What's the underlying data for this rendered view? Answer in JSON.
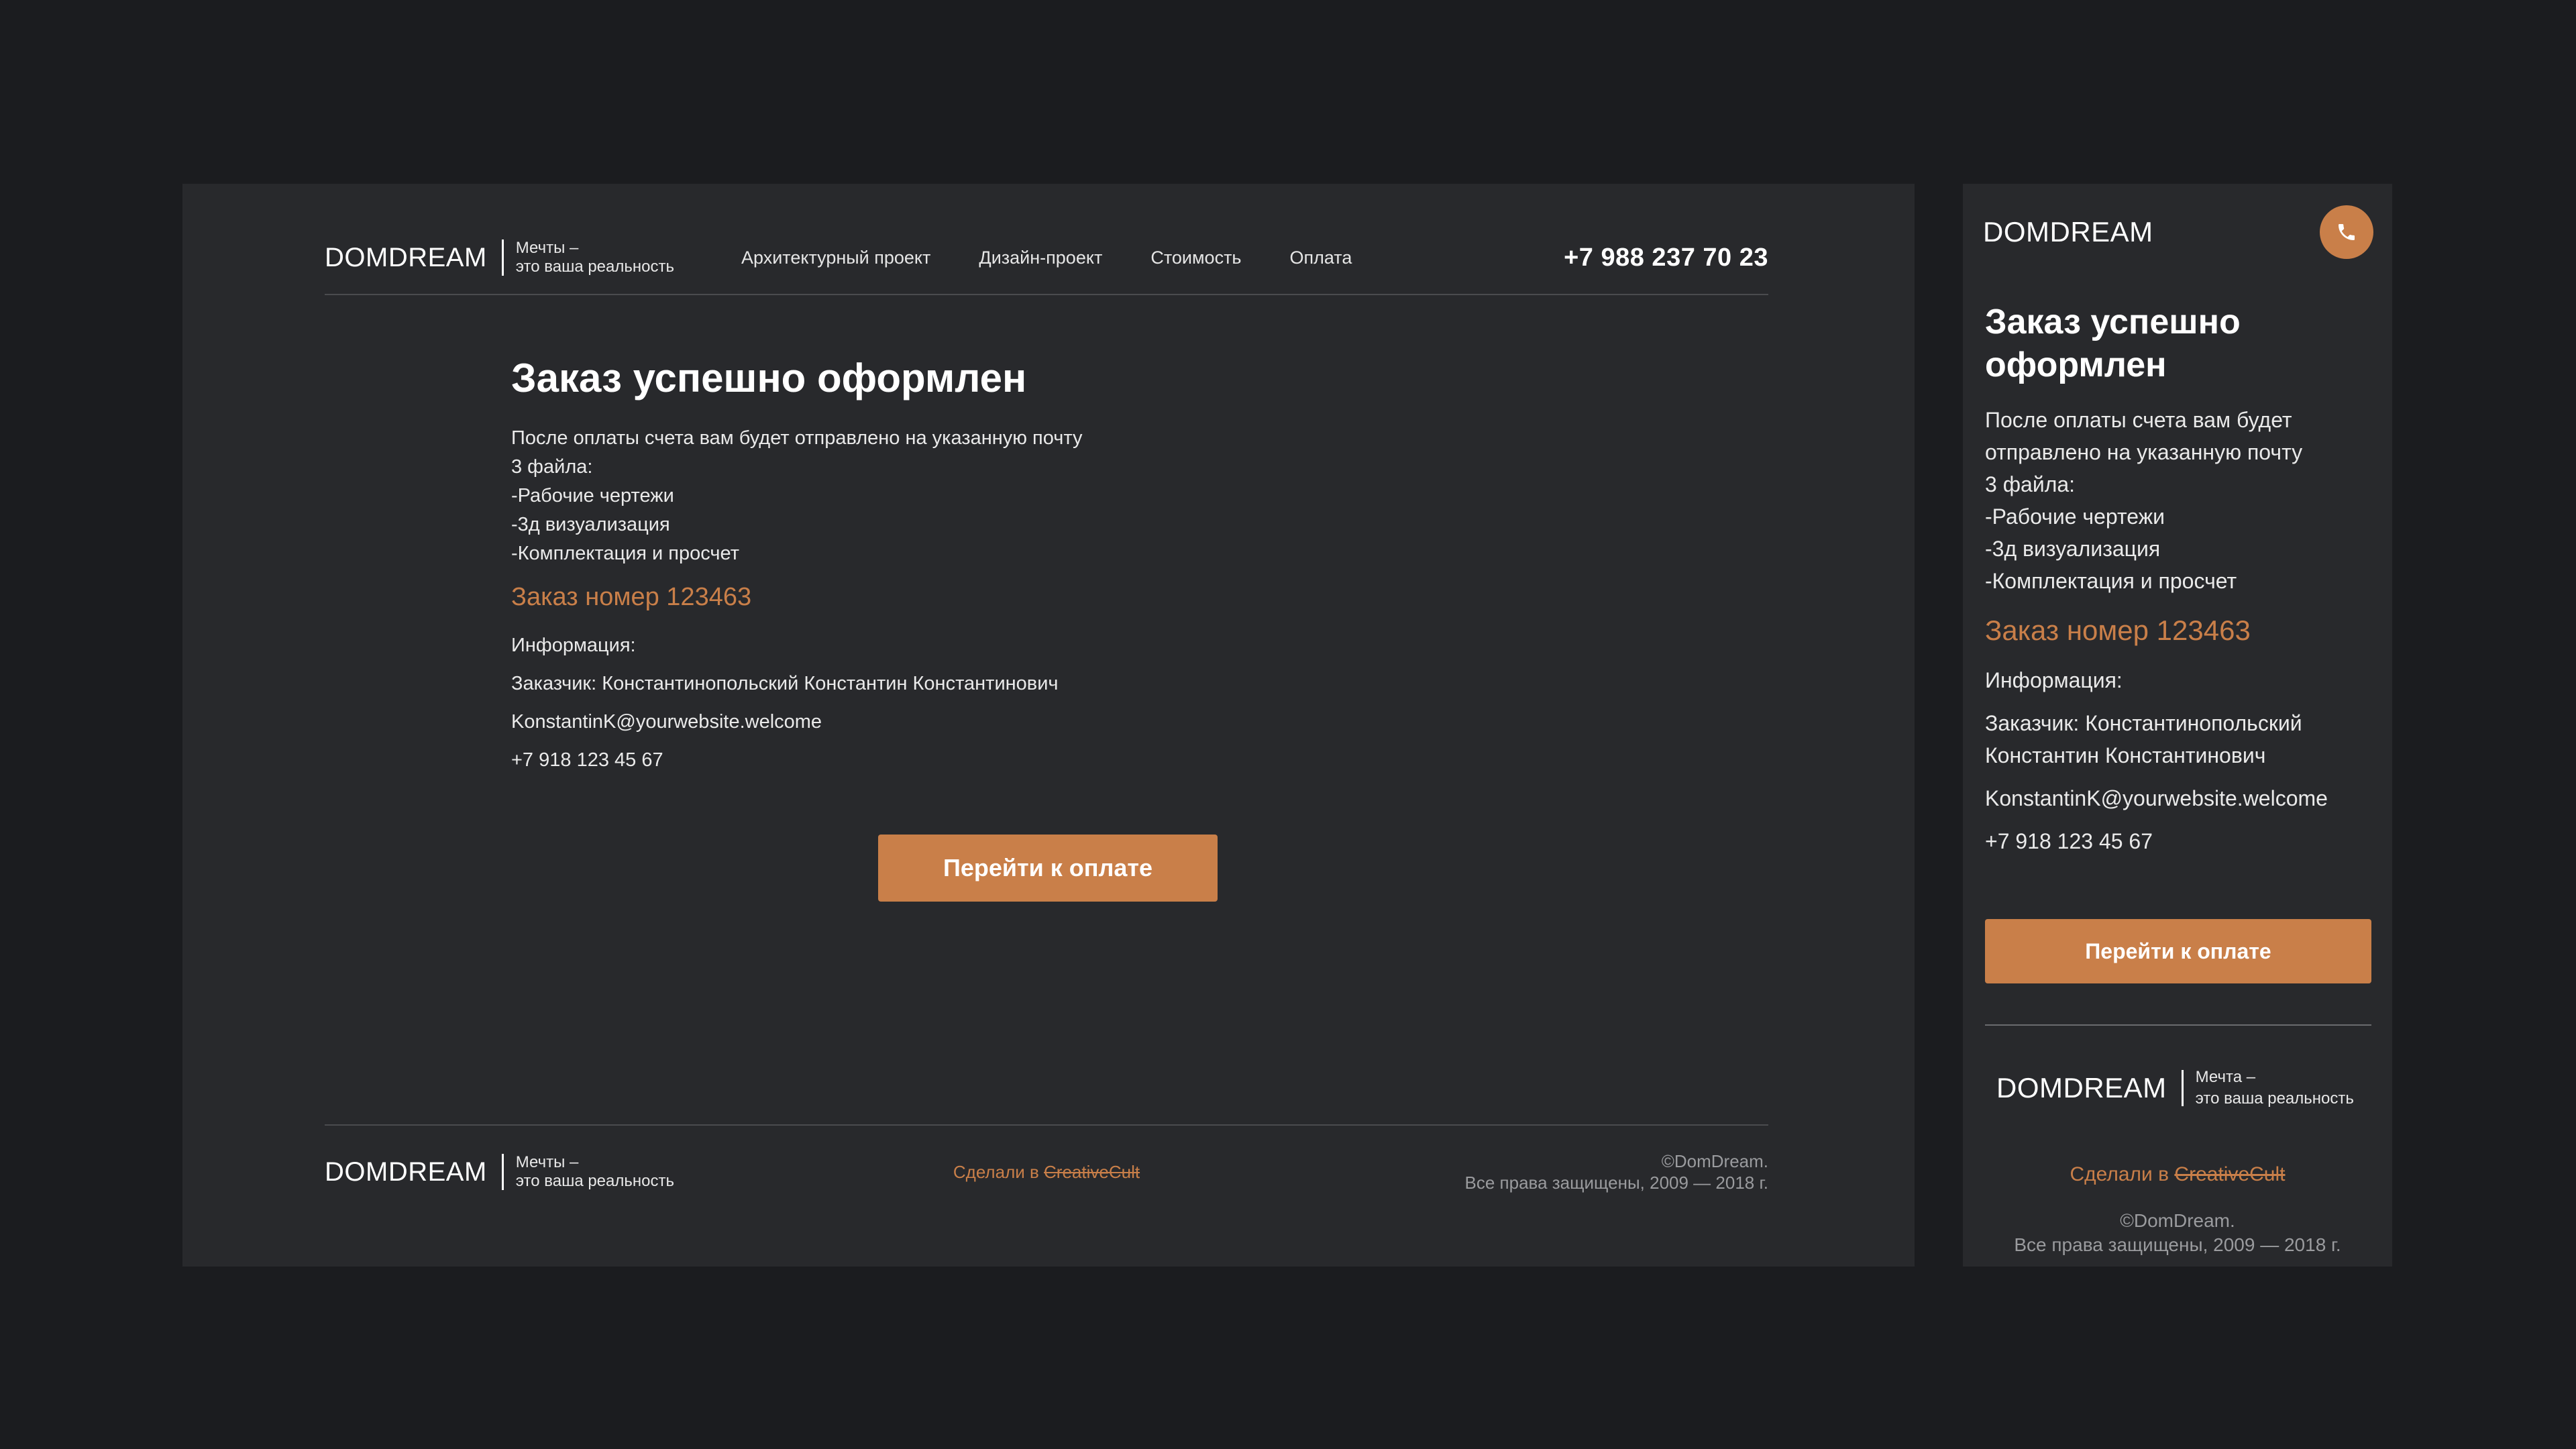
{
  "brand": {
    "name": "DOMDREAM",
    "tagline_1": "Мечты –",
    "tagline_2": "это ваша реальность",
    "tagline_mobile_1": "Мечта –",
    "tagline_mobile_2": "это ваша реальность"
  },
  "nav": {
    "items": [
      {
        "label": "Архитектурный проект"
      },
      {
        "label": "Дизайн-проект"
      },
      {
        "label": "Стоимость"
      },
      {
        "label": "Оплата"
      }
    ]
  },
  "header": {
    "phone": "+7 988 237 70 23"
  },
  "order": {
    "title": "Заказ успешно оформлен",
    "intro_line_1": "После оплаты счета вам будет отправлено  на указанную почту",
    "intro_line_2": "3 файла:",
    "file_1": "-Рабочие чертежи",
    "file_2": "-3д визуализация",
    "file_3": "-Комплектация и просчет",
    "order_number": "Заказ номер 123463",
    "info_label": "Информация:",
    "customer": "Заказчик: Константинопольский Константин Константинович",
    "email": "KonstantinK@yourwebsite.welcome",
    "phone": "+7 918 123 45 67",
    "pay_button": "Перейти к оплате"
  },
  "mobile": {
    "intro_line_1": "После оплаты счета вам будет",
    "intro_line_2": "отправлено на указанную почту",
    "customer_line_1": "Заказчик: Константинопольский",
    "customer_line_2": "Константин Константинович"
  },
  "footer": {
    "made_prefix": "Сделали в ",
    "made_by": "CreativeCult",
    "copyright_1": "©DomDream.",
    "copyright_2": "Все права защищены, 2009 — 2018 г."
  },
  "colors": {
    "accent": "#c97f49",
    "background": "#1b1c1f",
    "panel": "#28292c"
  },
  "icons": {
    "phone_button": "phone-icon"
  }
}
